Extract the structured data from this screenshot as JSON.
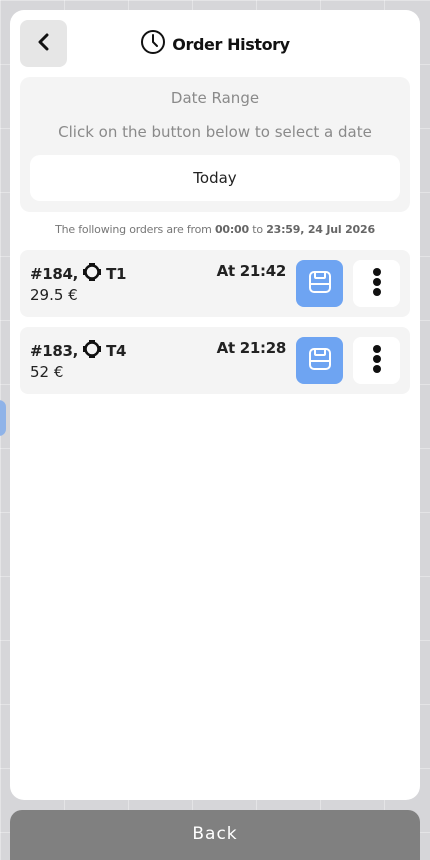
{
  "header": {
    "title": "Order History",
    "title_icon": "clock-icon",
    "back_icon": "chevron-left-icon"
  },
  "date_range": {
    "label": "Date Range",
    "hint": "Click on the button below to select a date",
    "button_label": "Today"
  },
  "range_info": {
    "prefix": "The following orders are from",
    "from": "00:00",
    "connector": "to",
    "to": "23:59, 24 Jul 2026"
  },
  "orders": [
    {
      "id": "#184,",
      "table": "T1",
      "price": "29.5 €",
      "time": "At 21:42"
    },
    {
      "id": "#183,",
      "table": "T4",
      "price": "52 €",
      "time": "At 21:28"
    }
  ],
  "footer": {
    "back_label": "Back"
  },
  "colors": {
    "accent": "#6ea4f2",
    "panel": "#ffffff",
    "card": "#f4f4f4",
    "footer": "#808080"
  }
}
